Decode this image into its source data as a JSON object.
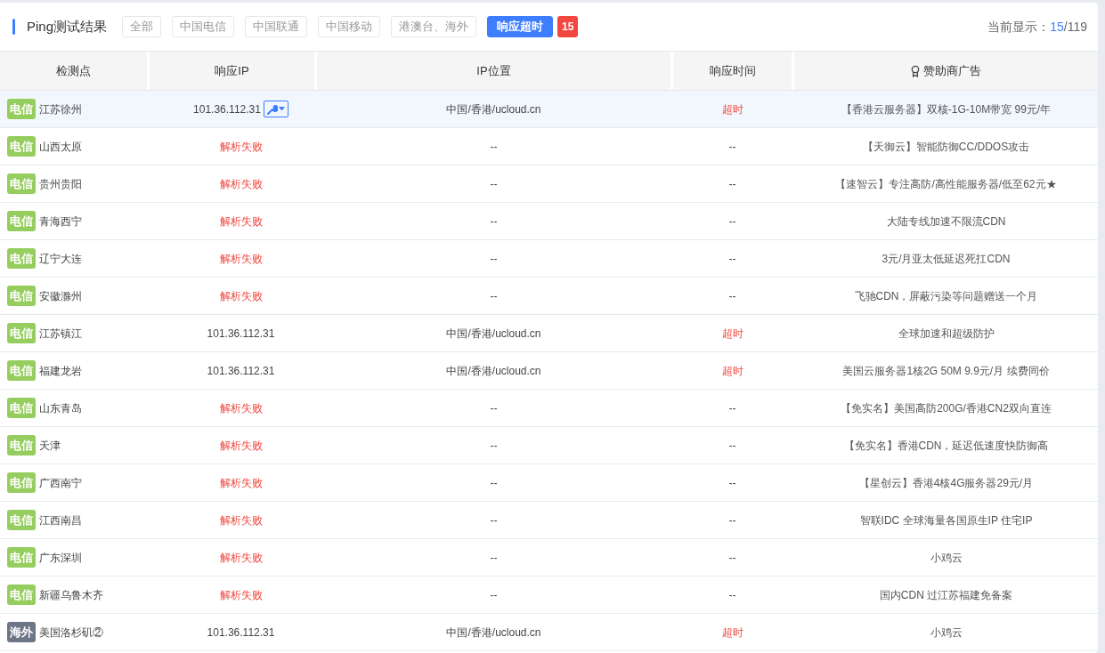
{
  "header": {
    "title": "Ping测试结果",
    "filters": [
      {
        "label": "全部",
        "selected": false
      },
      {
        "label": "中国电信",
        "selected": false
      },
      {
        "label": "中国联通",
        "selected": false
      },
      {
        "label": "中国移动",
        "selected": false
      },
      {
        "label": "港澳台、海外",
        "selected": false
      },
      {
        "label": "响应超时",
        "selected": true
      }
    ],
    "count_badge": "15",
    "display_label": "当前显示：",
    "display_shown": "15",
    "display_total": "/119"
  },
  "table": {
    "columns": [
      "检测点",
      "响应IP",
      "IP位置",
      "响应时间",
      "赞助商广告"
    ],
    "rows": [
      {
        "tag": "电信",
        "kind": "telecom",
        "location": "江苏徐州",
        "ip": "101.36.112.31",
        "ip_failed": false,
        "tool_button": true,
        "ip_location": "中国/香港/ucloud.cn",
        "time": "超时",
        "timeout": true,
        "ad": "【香港云服务器】双核-1G-10M带宽 99元/年",
        "selected": true
      },
      {
        "tag": "电信",
        "kind": "telecom",
        "location": "山西太原",
        "ip": "解析失败",
        "ip_failed": true,
        "tool_button": false,
        "ip_location": "--",
        "time": "--",
        "timeout": false,
        "ad": "【天御云】智能防御CC/DDOS攻击",
        "selected": false
      },
      {
        "tag": "电信",
        "kind": "telecom",
        "location": "贵州贵阳",
        "ip": "解析失败",
        "ip_failed": true,
        "tool_button": false,
        "ip_location": "--",
        "time": "--",
        "timeout": false,
        "ad": "【速智云】专注高防/高性能服务器/低至62元★",
        "selected": false
      },
      {
        "tag": "电信",
        "kind": "telecom",
        "location": "青海西宁",
        "ip": "解析失败",
        "ip_failed": true,
        "tool_button": false,
        "ip_location": "--",
        "time": "--",
        "timeout": false,
        "ad": "大陆专线加速不限流CDN",
        "selected": false
      },
      {
        "tag": "电信",
        "kind": "telecom",
        "location": "辽宁大连",
        "ip": "解析失败",
        "ip_failed": true,
        "tool_button": false,
        "ip_location": "--",
        "time": "--",
        "timeout": false,
        "ad": "3元/月亚太低延迟死扛CDN",
        "selected": false
      },
      {
        "tag": "电信",
        "kind": "telecom",
        "location": "安徽滁州",
        "ip": "解析失败",
        "ip_failed": true,
        "tool_button": false,
        "ip_location": "--",
        "time": "--",
        "timeout": false,
        "ad": "飞驰CDN，屏蔽污染等问题赠送一个月",
        "selected": false
      },
      {
        "tag": "电信",
        "kind": "telecom",
        "location": "江苏镇江",
        "ip": "101.36.112.31",
        "ip_failed": false,
        "tool_button": false,
        "ip_location": "中国/香港/ucloud.cn",
        "time": "超时",
        "timeout": true,
        "ad": "全球加速和超级防护",
        "selected": false
      },
      {
        "tag": "电信",
        "kind": "telecom",
        "location": "福建龙岩",
        "ip": "101.36.112.31",
        "ip_failed": false,
        "tool_button": false,
        "ip_location": "中国/香港/ucloud.cn",
        "time": "超时",
        "timeout": true,
        "ad": "美国云服务器1核2G 50M 9.9元/月 续费同价",
        "selected": false
      },
      {
        "tag": "电信",
        "kind": "telecom",
        "location": "山东青岛",
        "ip": "解析失败",
        "ip_failed": true,
        "tool_button": false,
        "ip_location": "--",
        "time": "--",
        "timeout": false,
        "ad": "【免实名】美国高防200G/香港CN2双向直连",
        "selected": false
      },
      {
        "tag": "电信",
        "kind": "telecom",
        "location": "天津",
        "ip": "解析失败",
        "ip_failed": true,
        "tool_button": false,
        "ip_location": "--",
        "time": "--",
        "timeout": false,
        "ad": "【免实名】香港CDN，延迟低速度快防御高",
        "selected": false
      },
      {
        "tag": "电信",
        "kind": "telecom",
        "location": "广西南宁",
        "ip": "解析失败",
        "ip_failed": true,
        "tool_button": false,
        "ip_location": "--",
        "time": "--",
        "timeout": false,
        "ad": "【星创云】香港4核4G服务器29元/月",
        "selected": false
      },
      {
        "tag": "电信",
        "kind": "telecom",
        "location": "江西南昌",
        "ip": "解析失败",
        "ip_failed": true,
        "tool_button": false,
        "ip_location": "--",
        "time": "--",
        "timeout": false,
        "ad": "智联IDC 全球海量各国原生IP 住宅IP",
        "selected": false
      },
      {
        "tag": "电信",
        "kind": "telecom",
        "location": "广东深圳",
        "ip": "解析失败",
        "ip_failed": true,
        "tool_button": false,
        "ip_location": "--",
        "time": "--",
        "timeout": false,
        "ad": "小鸡云",
        "selected": false
      },
      {
        "tag": "电信",
        "kind": "telecom",
        "location": "新疆乌鲁木齐",
        "ip": "解析失败",
        "ip_failed": true,
        "tool_button": false,
        "ip_location": "--",
        "time": "--",
        "timeout": false,
        "ad": "国内CDN 过江苏福建免备案",
        "selected": false
      },
      {
        "tag": "海外",
        "kind": "overseas",
        "location": "美国洛杉矶②",
        "ip": "101.36.112.31",
        "ip_failed": false,
        "tool_button": false,
        "ip_location": "中国/香港/ucloud.cn",
        "time": "超时",
        "timeout": true,
        "ad": "小鸡云",
        "selected": false
      }
    ]
  }
}
